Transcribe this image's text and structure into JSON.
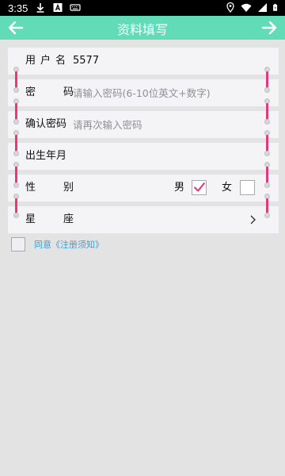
{
  "status_bar": {
    "time": "3:35",
    "left_icons": [
      "download-icon",
      "a-icon",
      "keyboard-icon"
    ],
    "right_icons": [
      "location-icon",
      "wifi-icon",
      "signal-icon",
      "battery-icon"
    ]
  },
  "header": {
    "title": "资料填写",
    "back_icon": "arrow-left-icon",
    "next_icon": "arrow-right-icon",
    "color": "#62dbb7"
  },
  "form": {
    "username": {
      "label": "用户名",
      "value": "5577"
    },
    "password": {
      "label": "密码",
      "placeholder": "请输入密码(6-10位英文+数字)"
    },
    "confirm_password": {
      "label": "确认密码",
      "placeholder": "请再次输入密码"
    },
    "birthday": {
      "label": "出生年月"
    },
    "gender": {
      "label": "性别",
      "male_label": "男",
      "male_checked": true,
      "female_label": "女",
      "female_checked": false
    },
    "constellation": {
      "label": "星座",
      "chevron_icon": "chevron-right-icon"
    }
  },
  "agreement": {
    "checked": false,
    "text": "同意《注册须知》"
  },
  "colors": {
    "ring": "#e23b77",
    "link": "#3aa0d6",
    "background": "#e4e3e4"
  }
}
